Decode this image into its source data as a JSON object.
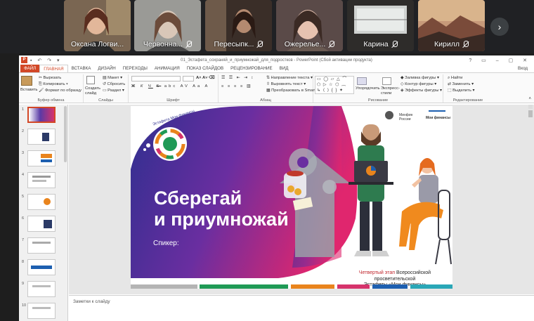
{
  "participants": [
    {
      "name": "Оксана Логви...",
      "muted": false
    },
    {
      "name": "Червонна...",
      "muted": true
    },
    {
      "name": "Пересыпк...",
      "muted": true
    },
    {
      "name": "Ожерелье...",
      "muted": true
    },
    {
      "name": "Карина",
      "muted": true
    },
    {
      "name": "Кирилл",
      "muted": true
    }
  ],
  "next_label": "›",
  "ppt": {
    "title": "01_Эстафета_сохраняй_и_приумножай_для_подростков - PowerPoint (Сбой активации продукта)",
    "login": "Вход",
    "tabs": [
      "ФАЙЛ",
      "ГЛАВНАЯ",
      "ВСТАВКА",
      "ДИЗАЙН",
      "ПЕРЕХОДЫ",
      "АНИМАЦИЯ",
      "ПОКАЗ СЛАЙДОВ",
      "РЕЦЕНЗИРОВАНИЕ",
      "ВИД"
    ],
    "ribbon": {
      "clipboard": {
        "paste": "Вставить",
        "cut": "Вырезать",
        "copy": "Копировать",
        "format": "Формат по образцу",
        "label": "Буфер обмена"
      },
      "slides": {
        "new": "Создать слайд",
        "layout": "Макет",
        "reset": "Сбросить",
        "section": "Раздел",
        "label": "Слайды"
      },
      "font": {
        "label": "Шрифт",
        "bold": "Ж",
        "italic": "К",
        "underline": "Ч",
        "strike": "S",
        "abc": "abc"
      },
      "paragraph": {
        "direction": "Направление текста",
        "align": "Выровнять текст",
        "smartart": "Преобразовать в SmartArt",
        "label": "Абзац"
      },
      "drawing": {
        "arrange": "Упорядочить",
        "styles": "Экспресс-стили",
        "fill": "Заливка фигуры",
        "outline": "Контур фигуры",
        "effects": "Эффекты фигуры",
        "label": "Рисование"
      },
      "editing": {
        "find": "Найти",
        "replace": "Заменить",
        "select": "Выделить",
        "label": "Редактирование"
      }
    },
    "slide_numbers": [
      "1",
      "2",
      "3",
      "4",
      "5",
      "6",
      "7",
      "8",
      "9",
      "10"
    ],
    "slide": {
      "badge": "Эстафета Мои финансы",
      "title_line1": "Сберегай",
      "title_line2": "и приумножай",
      "speaker": "Спикер:",
      "minfin": "Минфин России",
      "moifin": "Мои финансы",
      "footer_red": "Четвертый этап",
      "footer_rest": " Всероссийской просветительской",
      "footer_line2": "Эстафеты «Мои финансы»",
      "bar_colors": [
        "#b4b4b4",
        "#1f9a56",
        "#e9841d",
        "#d6336c",
        "#1d5fb0",
        "#2aa7b7"
      ]
    },
    "notes_placeholder": "Заметки к слайду"
  }
}
